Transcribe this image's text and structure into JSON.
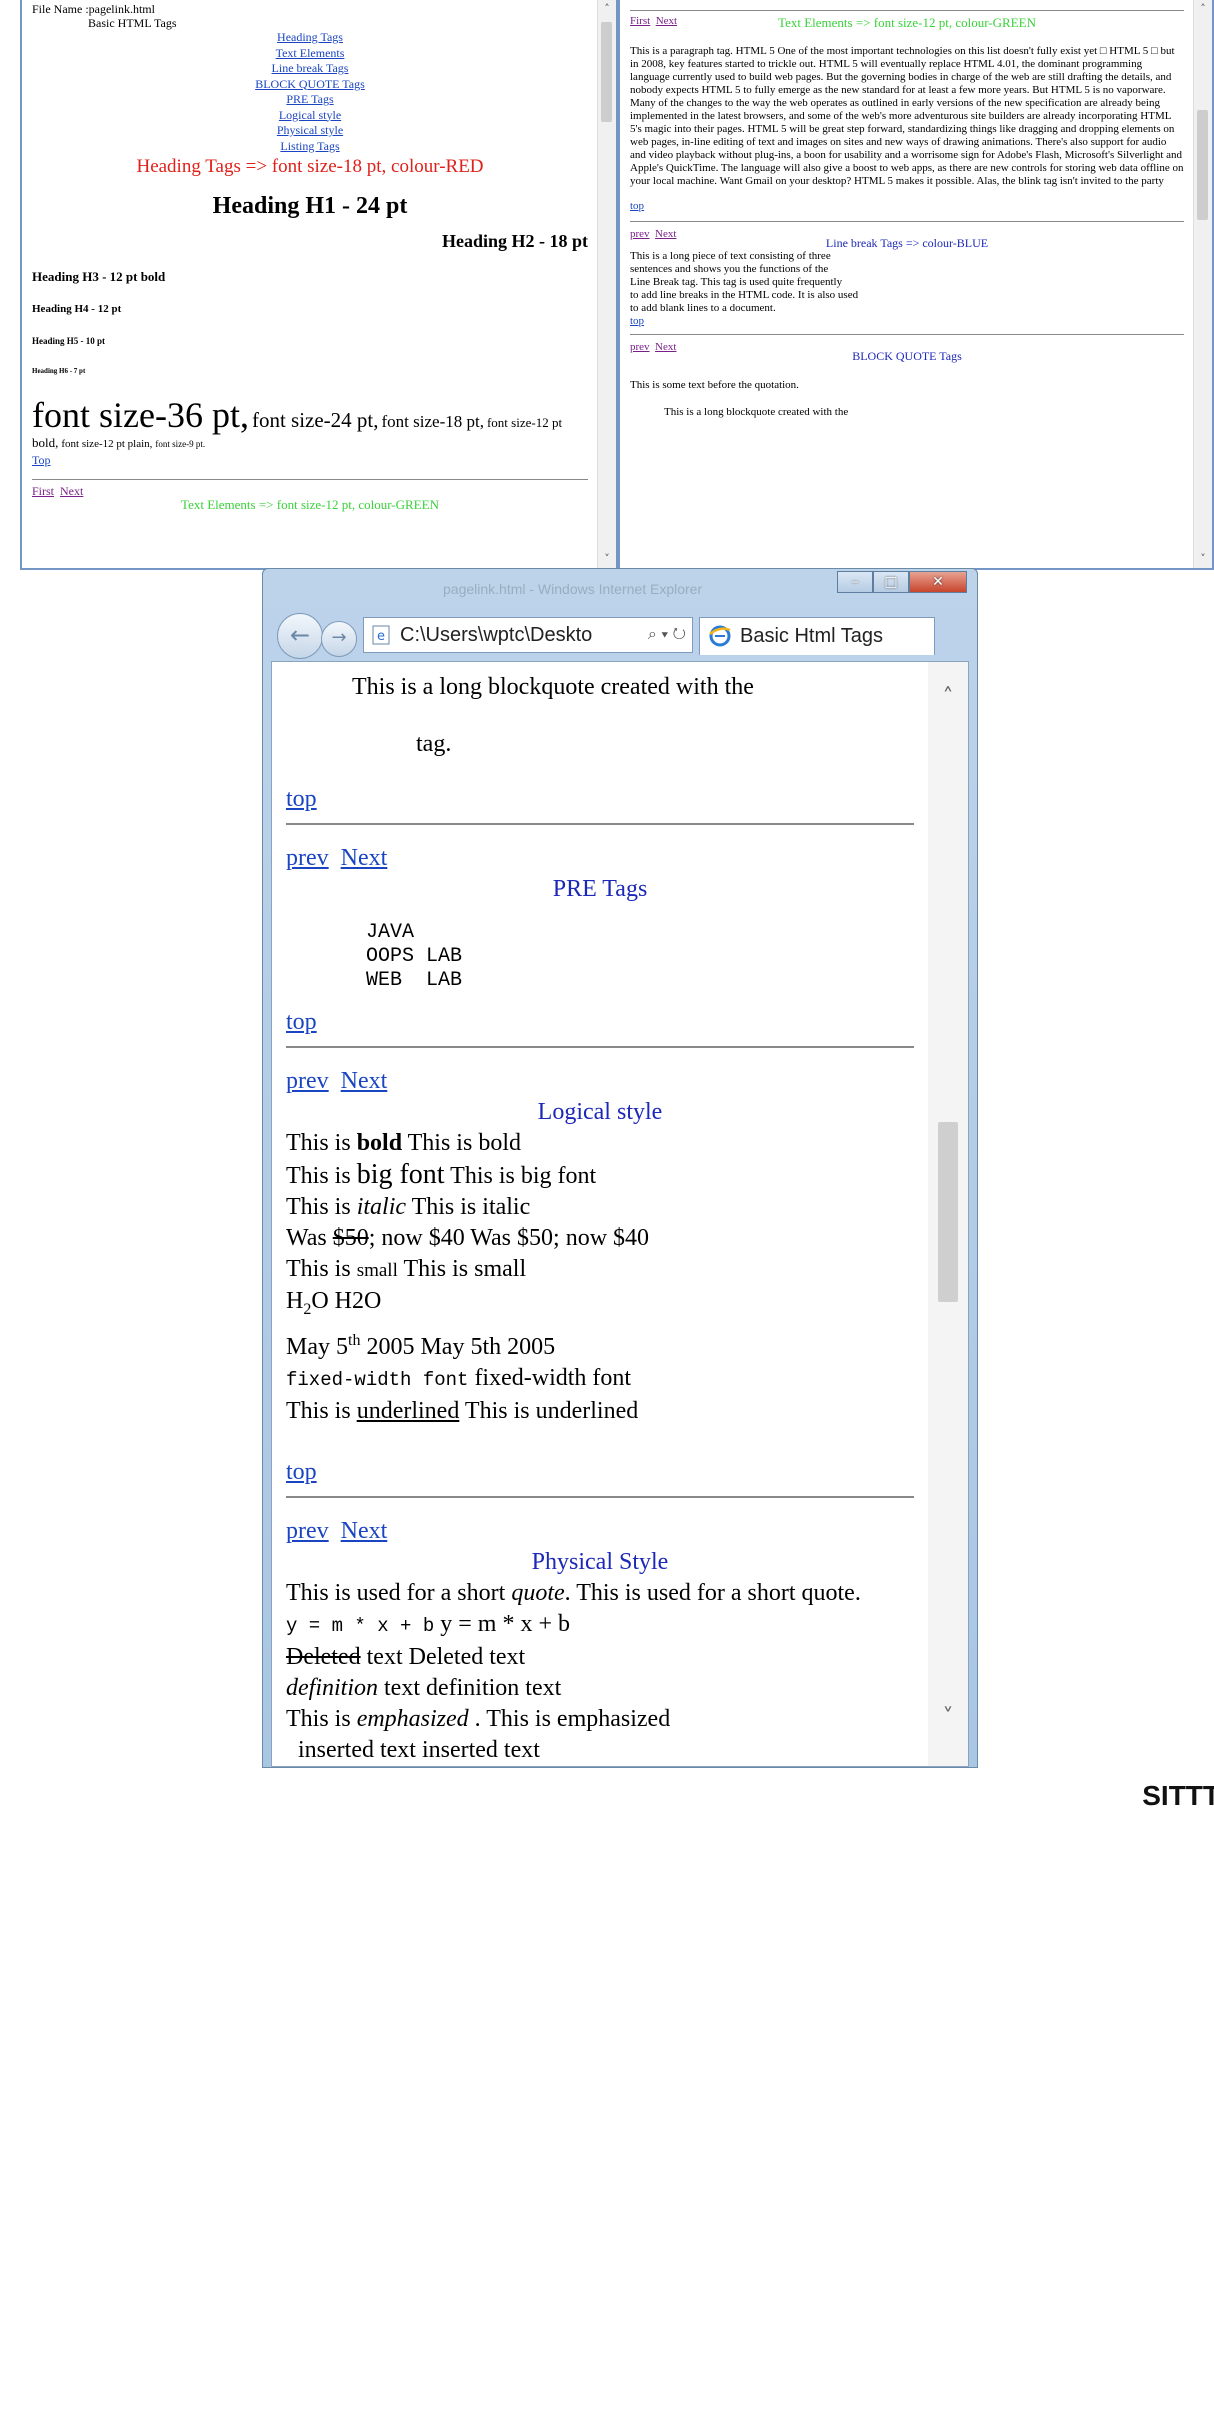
{
  "left_window": {
    "file_name": "File Name :pagelink.html",
    "page_title": "Basic HTML Tags",
    "toc": [
      "Heading Tags",
      "Text Elements",
      "Line break Tags",
      "BLOCK QUOTE Tags",
      "PRE Tags",
      "Logical style",
      "Physical style",
      "Listing Tags"
    ],
    "heading_section_title": "Heading Tags => font size-18 pt, colour-RED",
    "h1": "Heading H1 - 24 pt",
    "h2": "Heading H2 - 18 pt",
    "h3": "Heading H3 - 12 pt bold",
    "h4": "Heading H4 - 12 pt",
    "h5": "Heading H5 - 10 pt",
    "h6": "Heading H6 - 7 pt",
    "font_36": "font size-36 pt,",
    "font_24": "font size-24 pt,",
    "font_18": "font size-18 pt,",
    "font_12b": "font size-12 pt bold,",
    "font_12p": "font size-12 pt plain,",
    "font_9": "font size-9 pt.",
    "top_link": "Top",
    "nav_first": "First",
    "nav_next": "Next",
    "text_elements_title": "Text Elements => font size-12 pt, colour-GREEN"
  },
  "right_window": {
    "nav_first": "First",
    "nav_next": "Next",
    "text_elements_title": "Text Elements => font size-12 pt, colour-GREEN",
    "paragraph": "This is a paragraph tag. HTML 5 One of the most important technologies on this list doesn't fully exist yet □ HTML 5 □ but in 2008, key features started to trickle out. HTML 5 will eventually replace HTML 4.01, the dominant programming language currently used to build web pages. But the governing bodies in charge of the web are still drafting the details, and nobody expects HTML 5 to fully emerge as the new standard for at least a few more years. But HTML 5 is no vaporware. Many of the changes to the way the web operates as outlined in early versions of the new specification are already being implemented in the latest browsers, and some of the web's more adventurous site builders are already incorporating HTML 5's magic into their pages. HTML 5 will be great step forward, standardizing things like dragging and dropping elements on web pages, in-line editing of text and images on sites and new ways of drawing animations. There's also support for audio and video playback without plug-ins, a boon for usability and a worrisome sign for Adobe's Flash, Microsoft's Silverlight and Apple's QuickTime. The language will also give a boost to web apps, as there are new controls for storing web data offline on your local machine. Want Gmail on your desktop? HTML 5 makes it possible. Alas, the blink tag isn't invited to the party",
    "top_link": "top",
    "nav_prev": "prev",
    "nav_next2": "Next",
    "line_break_title": "Line break Tags => colour-BLUE",
    "line_break_lines": [
      "This is a long piece of text consisting of three",
      "sentences and shows you the functions of the",
      "Line Break tag. This tag is used quite frequently",
      "to add line breaks in the HTML code. It is also used",
      "to add blank lines to a document."
    ],
    "top_link2": "top",
    "nav_prev2": "prev",
    "nav_next3": "Next",
    "blockquote_title": "BLOCK QUOTE Tags",
    "before_quote": "This is some text before the quotation.",
    "blockquote_start": "This is a long blockquote created with the"
  },
  "ie_window": {
    "ghost_title": "pagelink.html - Windows Internet Explorer",
    "address": "C:\\Users\\wptc\\Deskto",
    "tab_title": "Basic Html Tags",
    "blockquote_line1": "This is a long blockquote created with the",
    "blockquote_line2": "tag.",
    "top1": "top",
    "prev1": "prev",
    "next1": "Next",
    "pre_title": "PRE Tags",
    "pre_lines": "JAVA\nOOPS LAB\nWEB  LAB",
    "top2": "top",
    "prev2": "prev",
    "next2": "Next",
    "logical_title": "Logical style",
    "logical": {
      "this_is": "This is",
      "bold": "bold",
      "bold_plain": "This is bold",
      "big": "big font",
      "big_plain": "This is big font",
      "italic": "italic",
      "italic_plain": "This is italic",
      "was": "Was",
      "strike": "$50",
      "now": "; now $40 Was $50; now $40",
      "small": "small",
      "small_plain": "This is small",
      "h": "H",
      "sub": "2",
      "o": "O H2O",
      "may": "May 5",
      "sup": "th",
      "may_rest": "2005 May 5th 2005",
      "fixed": "fixed-width font",
      "fixed_plain": "fixed-width font",
      "underlined": "underlined",
      "underlined_plain": "This is underlined"
    },
    "top3": "top",
    "prev3": "prev",
    "next3": "Next",
    "physical_title": "Physical Style",
    "physical": {
      "quote_pre": "This is used for a short",
      "quote": "quote",
      "quote_post": ". This is used for a short quote.",
      "code": "y = m * x + b",
      "math": "y = m * x + b",
      "deleted": "Deleted",
      "deleted_post": "text Deleted text",
      "definition": "definition",
      "definition_post": "text definition text",
      "emph_pre": "This is",
      "emph": "emphasized",
      "emph_post": ". This is emphasized",
      "inserted": "inserted text inserted text"
    }
  },
  "footer_text": "SITTT"
}
